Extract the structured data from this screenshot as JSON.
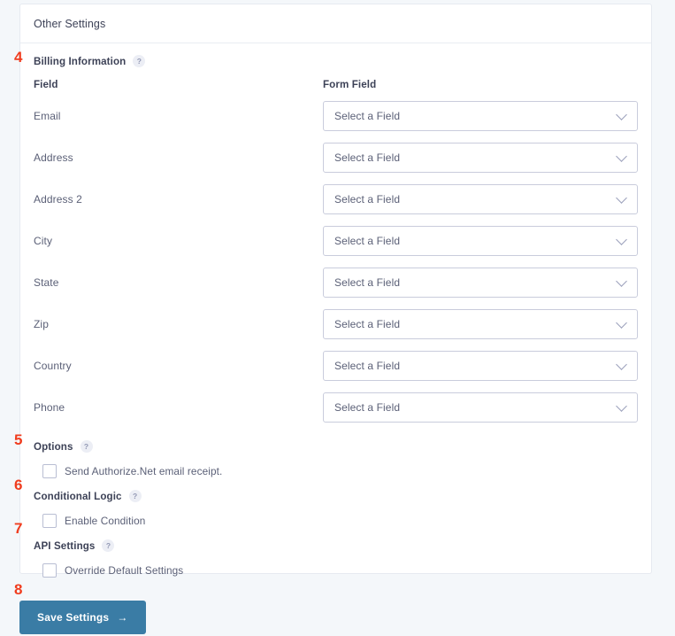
{
  "card": {
    "header_title": "Other Settings"
  },
  "billing": {
    "section_label": "Billing Information",
    "help_glyph": "?",
    "col_field_header": "Field",
    "col_form_header": "Form Field",
    "select_placeholder": "Select a Field",
    "chevron_icon": "chevron-down-icon",
    "rows": [
      {
        "field": "Email",
        "value": "Select a Field"
      },
      {
        "field": "Address",
        "value": "Select a Field"
      },
      {
        "field": "Address 2",
        "value": "Select a Field"
      },
      {
        "field": "City",
        "value": "Select a Field"
      },
      {
        "field": "State",
        "value": "Select a Field"
      },
      {
        "field": "Zip",
        "value": "Select a Field"
      },
      {
        "field": "Country",
        "value": "Select a Field"
      },
      {
        "field": "Phone",
        "value": "Select a Field"
      }
    ]
  },
  "options": {
    "section_label": "Options",
    "help_glyph": "?",
    "checkbox_label": "Send Authorize.Net email receipt.",
    "checked": false
  },
  "conditional_logic": {
    "section_label": "Conditional Logic",
    "help_glyph": "?",
    "checkbox_label": "Enable Condition",
    "checked": false
  },
  "api_settings": {
    "section_label": "API Settings",
    "help_glyph": "?",
    "checkbox_label": "Override Default Settings",
    "checked": false
  },
  "save": {
    "label": "Save Settings",
    "arrow_glyph": "→"
  },
  "markers": {
    "m4": "4",
    "m5": "5",
    "m6": "6",
    "m7": "7",
    "m8": "8"
  },
  "colors": {
    "page_background": "#f4f7fa",
    "card_background": "#ffffff",
    "card_border": "#e6eaf0",
    "text_primary": "#3d4257",
    "text_secondary": "#5b6077",
    "input_border": "#c9ccdc",
    "save_button": "#3a7ca5",
    "marker_red": "#f03c1e",
    "help_badge_bg": "#eceef5"
  }
}
